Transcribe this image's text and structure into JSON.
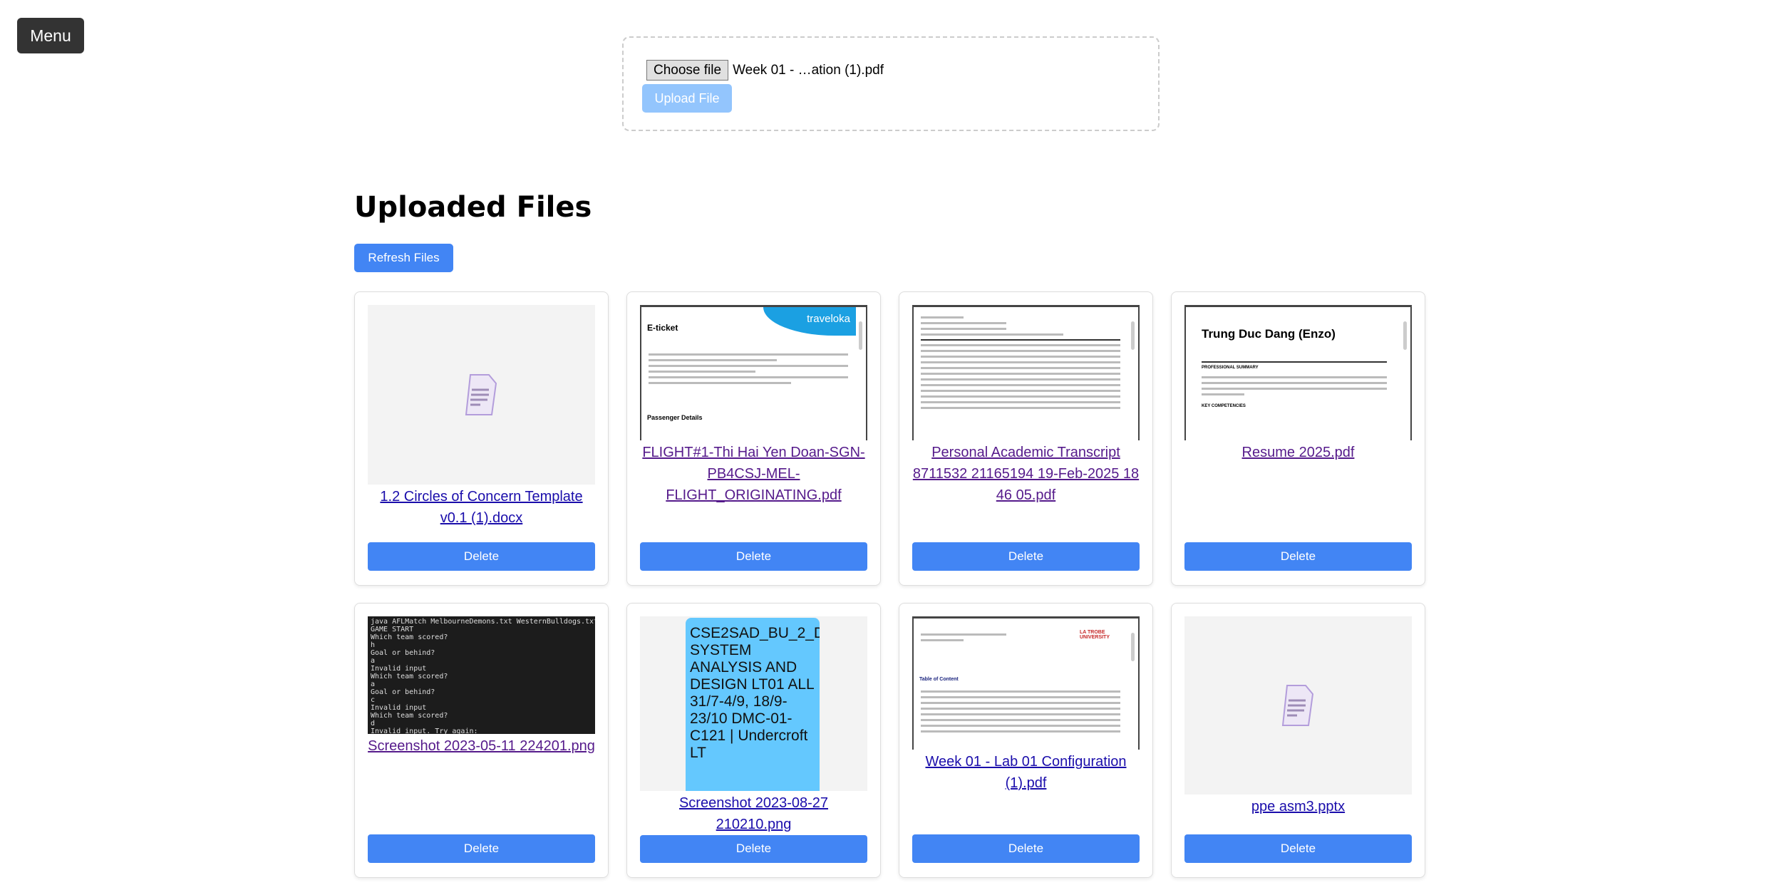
{
  "menu": {
    "label": "Menu"
  },
  "upload": {
    "choose_label": "Choose file",
    "selected_file": "Week 01 - …ation (1).pdf",
    "upload_label": "Upload File"
  },
  "files_section": {
    "title": "Uploaded Files",
    "refresh_label": "Refresh Files"
  },
  "colors": {
    "primary": "#4285f4",
    "disabled": "#93c5fd",
    "menu_bg": "#333333"
  },
  "files": [
    {
      "name": "1.2 Circles of Concern Template v0.1 (1).docx",
      "preview": "doc-icon",
      "delete_label": "Delete"
    },
    {
      "name": "FLIGHT#1-Thi Hai Yen Doan-SGN-PB4CSJ-MEL-FLIGHT_ORIGINATING.pdf",
      "preview": "pdf",
      "preview_title": "E-ticket",
      "preview_brand": "traveloka",
      "preview_section": "Passenger Details",
      "delete_label": "Delete"
    },
    {
      "name": "Personal Academic Transcript 8711532 21165194 19-Feb-2025 18 46 05.pdf",
      "preview": "pdf",
      "delete_label": "Delete"
    },
    {
      "name": "Resume 2025.pdf",
      "preview": "pdf",
      "preview_title": "Trung Duc Dang (Enzo)",
      "preview_section": "PROFESSIONAL SUMMARY",
      "preview_section2": "KEY COMPETENCIES",
      "delete_label": "Delete"
    },
    {
      "name": "Screenshot 2023-05-11 224201.png",
      "preview": "image",
      "preview_text": "java AFLMatch MelbourneDemons.txt WesternBulldogs.txt\nGAME START\nWhich team scored?\nh\nGoal or behind?\na\nInvalid input\nWhich team scored?\na\nGoal or behind?\nc\nInvalid input\nWhich team scored?\nd\nInvalid input. Try again:",
      "delete_label": "Delete"
    },
    {
      "name": "Screenshot 2023-08-27 210210.png",
      "preview": "image",
      "preview_text": "CSE2SAD_BU_2_D SYSTEM ANALYSIS AND DESIGN LT01 ALL 31/7-4/9, 18/9-23/10 DMC-01-C121 | Undercroft LT",
      "delete_label": "Delete"
    },
    {
      "name": "Week 01 - Lab 01 Configuration (1).pdf",
      "preview": "pdf",
      "preview_brand": "LA TROBE UNIVERSITY",
      "preview_section": "Table of Content",
      "delete_label": "Delete"
    },
    {
      "name": "ppe asm3.pptx",
      "preview": "doc-icon",
      "delete_label": "Delete"
    }
  ]
}
